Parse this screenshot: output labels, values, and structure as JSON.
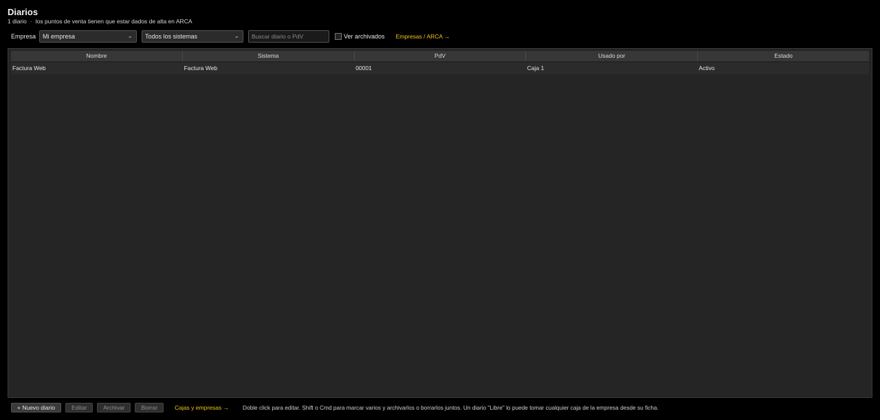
{
  "header": {
    "title": "Diarios",
    "count_text": "1 diario",
    "separator": "·",
    "note": "los puntos de venta tienen que estar dados de alta en ARCA"
  },
  "toolbar": {
    "empresa_label": "Empresa",
    "empresa_value": "Mi empresa",
    "sistema_value": "Todos los sistemas",
    "search_placeholder": "Buscar diario o PdV",
    "archived_label": "Ver archivados",
    "archived_checked": false,
    "empresas_link": "Empresas / ARCA →"
  },
  "table": {
    "columns": [
      "Nombre",
      "Sistema",
      "PdV",
      "Usado por",
      "Estado"
    ],
    "rows": [
      [
        "Factura Web",
        "Factura Web",
        "00001",
        "Caja 1",
        "Activo"
      ]
    ]
  },
  "footer": {
    "new_button": "+ Nuevo diario",
    "edit_button": "Editar",
    "archive_button": "Archivar",
    "delete_button": "Borrar",
    "cajas_link": "Cajas y empresas →",
    "hint": "Doble click para editar. Shift o Cmd para marcar varios y archivarlos o borrarlos juntos. Un diario \"Libre\" lo puede tomar cualquier caja de la empresa desde su ficha."
  },
  "colors": {
    "background": "#000000",
    "panel": "#252525",
    "header_row": "#373737",
    "accent_link": "#f0c419"
  }
}
